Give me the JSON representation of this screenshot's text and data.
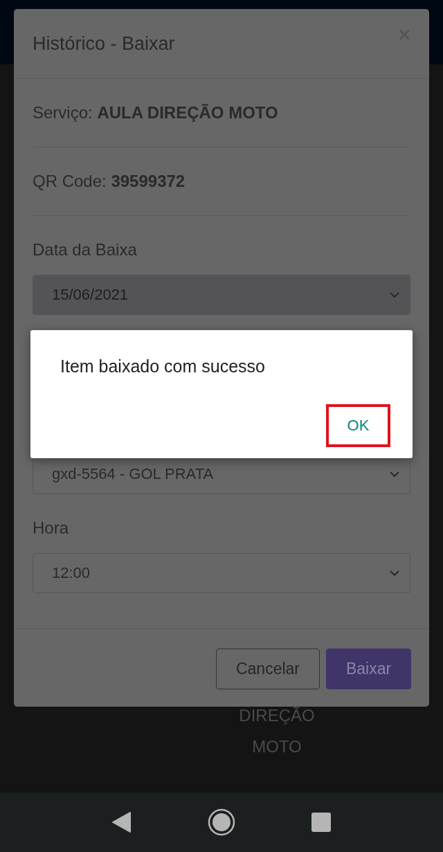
{
  "background": {
    "texts": [
      "DIREÇÃO",
      "MOTO"
    ]
  },
  "modal": {
    "title": "Histórico - Baixar",
    "close": "×",
    "info": [
      "Serviço: **AULA DIREÇÃO MOTO**",
      "QR Code: **39599372**"
    ],
    "fields": [
      {
        "label": "Data da Baixa",
        "value": "15/06/2021",
        "disabled": true
      },
      {
        "value": "gxd-5564 - GOL PRATA",
        "disabled": false
      },
      {
        "label": "Hora",
        "value": "12:00",
        "disabled": false
      }
    ],
    "buttons": [
      {
        "label": "Cancelar",
        "kind": "secondary"
      },
      {
        "label": "Baixar",
        "kind": "primary"
      }
    ]
  },
  "alert": {
    "message": "Item baixado com sucesso",
    "button": {
      "label": "OK",
      "highlighted": true
    }
  }
}
